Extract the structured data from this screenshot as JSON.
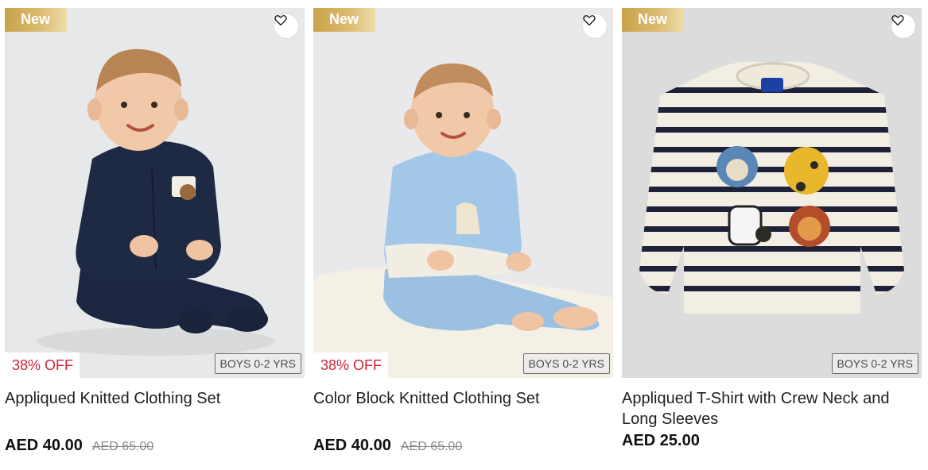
{
  "products": [
    {
      "badge": "New",
      "wishlist_icon": "heart-outline-icon",
      "discount": "38% OFF",
      "age": "BOYS 0-2 YRS",
      "title": "Appliqued Knitted Clothing Set",
      "price": "AED 40.00",
      "old_price": "AED 65.00",
      "colors": {
        "bg": "#e7e8ea",
        "outfit": "#1c2640"
      }
    },
    {
      "badge": "New",
      "wishlist_icon": "heart-outline-icon",
      "discount": "38% OFF",
      "age": "BOYS 0-2 YRS",
      "title": "Color Block Knitted Clothing Set",
      "price": "AED 40.00",
      "old_price": "AED 65.00",
      "colors": {
        "bg": "#e9e9eb",
        "outfit": "#9cc0e2"
      }
    },
    {
      "badge": "New",
      "wishlist_icon": "heart-outline-icon",
      "discount": "",
      "age": "BOYS 0-2 YRS",
      "title": "Appliqued T-Shirt with Crew Neck and Long Sleeves",
      "price": "AED 25.00",
      "old_price": "",
      "colors": {
        "bg": "#dcdcdc",
        "shirt": "#f2eee4",
        "stripe": "#1d2238"
      }
    }
  ]
}
